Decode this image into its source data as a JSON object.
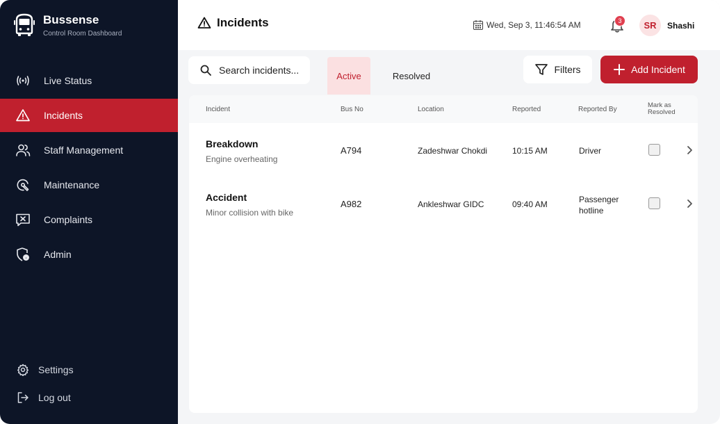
{
  "sidebar": {
    "brand_name": "Bussense",
    "brand_subtitle": "Control Room Dashboard",
    "items": [
      {
        "label": "Live Status",
        "icon": "broadcast-icon"
      },
      {
        "label": "Incidents",
        "icon": "warning-icon",
        "active": true
      },
      {
        "label": "Staff Management",
        "icon": "users-icon"
      },
      {
        "label": "Maintenance",
        "icon": "wrench-icon"
      },
      {
        "label": "Complaints",
        "icon": "complaint-icon"
      },
      {
        "label": "Admin",
        "icon": "shield-lock-icon"
      }
    ],
    "bottom": [
      {
        "label": "Settings",
        "icon": "gear-icon"
      },
      {
        "label": "Log out",
        "icon": "logout-icon"
      }
    ]
  },
  "header": {
    "title": "Incidents",
    "datetime": "Wed, Sep 3, 11:46:54 AM",
    "notification_count": "3",
    "avatar_initials": "SR",
    "user_name": "Shashi"
  },
  "toolbar": {
    "search_placeholder": "Search incidents...",
    "tab_active": "Active",
    "tab_resolved": "Resolved",
    "filters_label": "Filters",
    "add_label": "Add Incident"
  },
  "table": {
    "headers": {
      "incident": "Incident",
      "bus_no": "Bus No",
      "location": "Location",
      "reported": "Reported",
      "reported_by": "Reported By",
      "mark_resolved_1": "Mark as",
      "mark_resolved_2": "Resolved"
    },
    "rows": [
      {
        "title": "Breakdown",
        "desc": "Engine  overheating",
        "bus": "A794",
        "location": "Zadeshwar Chokdi",
        "time": "10:15 AM",
        "by_1": "Driver",
        "by_2": ""
      },
      {
        "title": "Accident",
        "desc": "Minor collision with bike",
        "bus": "A982",
        "location": "Ankleshwar GIDC",
        "time": "09:40 AM",
        "by_1": "Passenger",
        "by_2": "hotline"
      }
    ]
  },
  "colors": {
    "sidebar_bg": "#0d1527",
    "accent": "#c0202e",
    "accent_light": "#fbe0e1",
    "page_bg": "#f4f5f7"
  }
}
